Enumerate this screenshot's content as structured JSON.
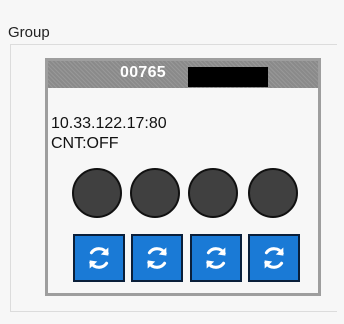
{
  "group": {
    "title": "Group"
  },
  "device": {
    "id": "00765",
    "address": "10.33.122.17:80",
    "counter": "CNT:OFF",
    "indicators": [
      {
        "name": "indicator-1",
        "color": "#404040"
      },
      {
        "name": "indicator-2",
        "color": "#404040"
      },
      {
        "name": "indicator-3",
        "color": "#404040"
      },
      {
        "name": "indicator-4",
        "color": "#404040"
      }
    ],
    "buttons": [
      {
        "name": "refresh-button-1",
        "icon": "refresh-icon"
      },
      {
        "name": "refresh-button-2",
        "icon": "refresh-icon"
      },
      {
        "name": "refresh-button-3",
        "icon": "refresh-icon"
      },
      {
        "name": "refresh-button-4",
        "icon": "refresh-icon"
      }
    ]
  },
  "colors": {
    "header_bg": "#8a8a8a",
    "button_bg": "#1a7ad6",
    "indicator_off": "#404040"
  }
}
